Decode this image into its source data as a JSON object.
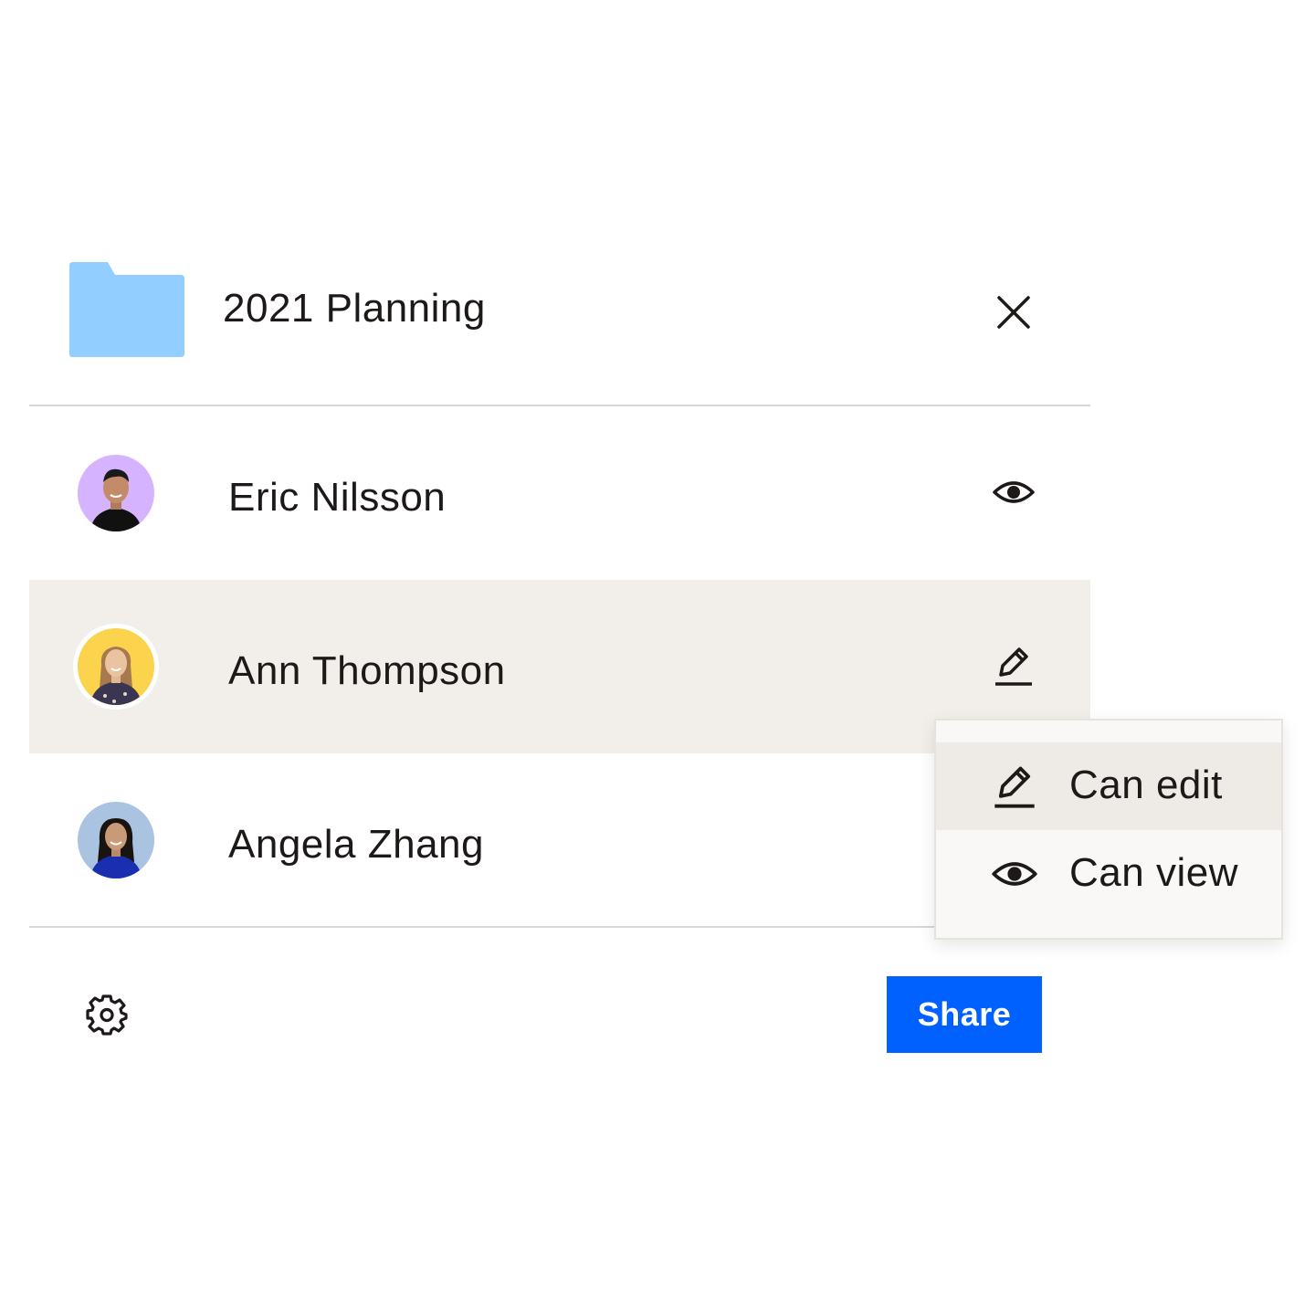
{
  "dialog": {
    "title": "2021 Planning",
    "folder_icon": "folder-icon",
    "folder_color": "#92ceff",
    "close_icon": "close-icon"
  },
  "members": [
    {
      "name": "Eric Nilsson",
      "permission": "Can view",
      "permission_icon": "eye-icon",
      "avatar_bg": "#d6b3ff",
      "active": false
    },
    {
      "name": "Ann Thompson",
      "permission": "Can edit",
      "permission_icon": "pencil-icon",
      "avatar_bg": "#fcd34d",
      "active": true
    },
    {
      "name": "Angela Zhang",
      "permission": "Can view",
      "permission_icon": "eye-icon",
      "avatar_bg": "#a9c3e0",
      "active": false
    }
  ],
  "permission_menu": {
    "items": [
      {
        "label": "Can edit",
        "icon": "pencil-icon",
        "selected": true
      },
      {
        "label": "Can view",
        "icon": "eye-icon",
        "selected": false
      }
    ]
  },
  "footer": {
    "settings_icon": "gear-icon",
    "share_label": "Share",
    "share_color": "#0061fe"
  }
}
